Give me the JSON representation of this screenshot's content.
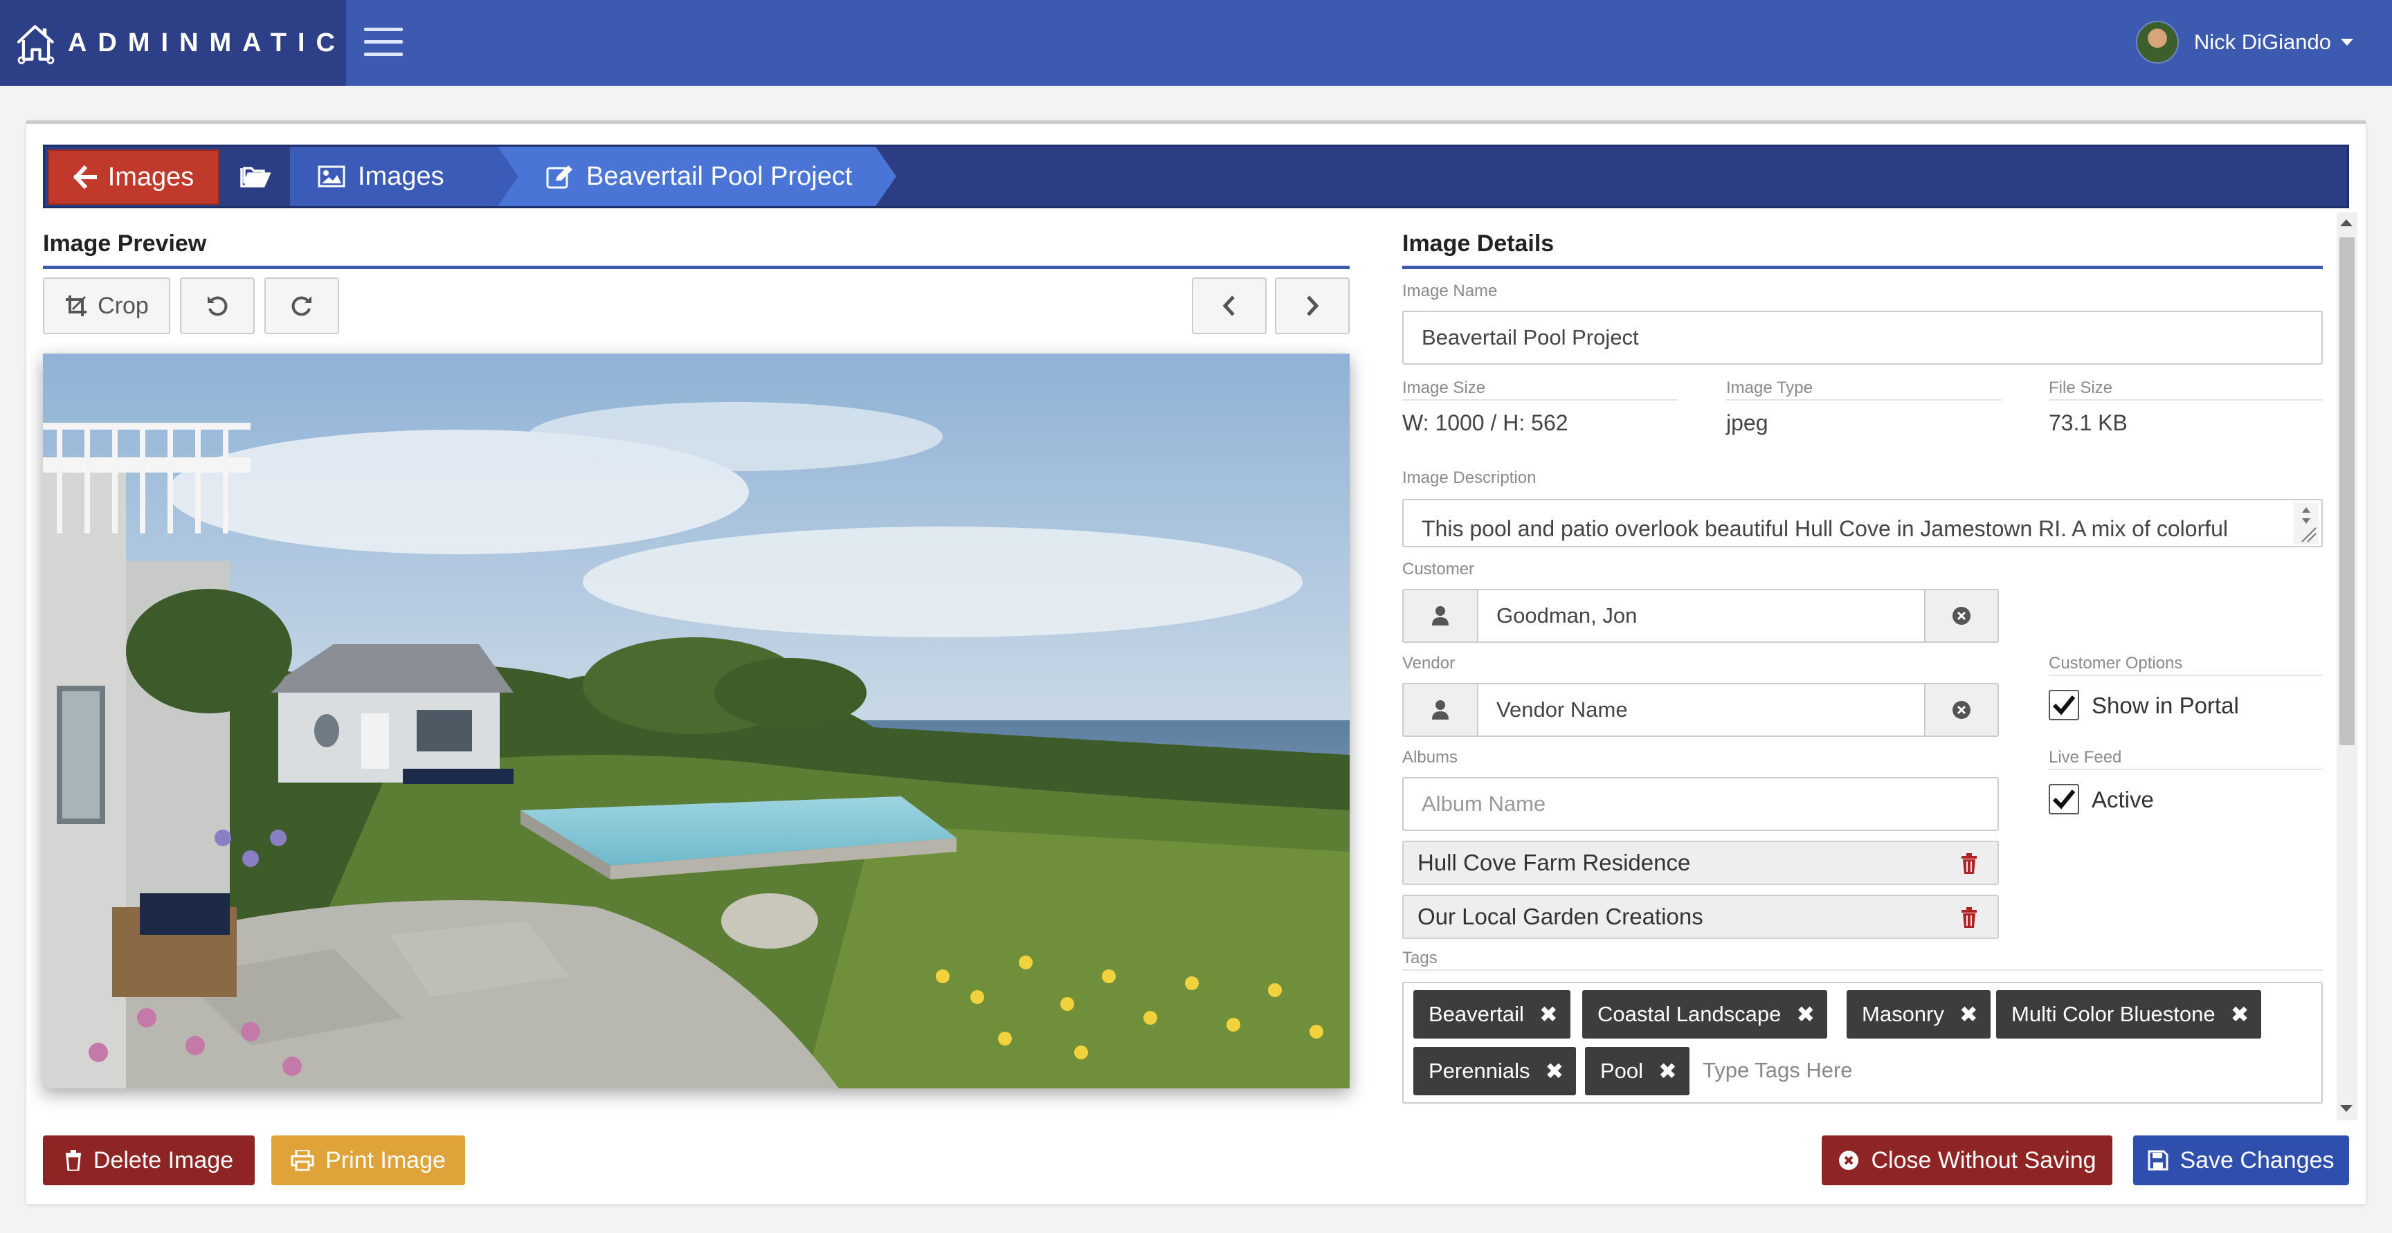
{
  "app": {
    "brand": "ADMINMATIC",
    "user_name": "Nick DiGiando"
  },
  "breadcrumb": {
    "back_label": "Images",
    "images_label": "Images",
    "current_label": "Beavertail Pool Project"
  },
  "preview": {
    "title": "Image Preview",
    "crop_label": "Crop"
  },
  "details": {
    "title": "Image Details",
    "name_label": "Image Name",
    "name_value": "Beavertail Pool Project",
    "size_label": "Image Size",
    "size_value": "W: 1000 / H: 562",
    "type_label": "Image Type",
    "type_value": "jpeg",
    "file_size_label": "File Size",
    "file_size_value": "73.1 KB",
    "description_label": "Image Description",
    "description_value": "This pool and patio overlook beautiful Hull Cove in Jamestown RI.  A mix of colorful",
    "customer_label": "Customer",
    "customer_value": "Goodman, Jon",
    "vendor_label": "Vendor",
    "vendor_placeholder": "Vendor Name",
    "albums_label": "Albums",
    "album_placeholder": "Album Name",
    "albums": [
      "Hull Cove Farm Residence",
      "Our Local Garden Creations"
    ],
    "customer_options_label": "Customer Options",
    "show_in_portal_label": "Show in Portal",
    "show_in_portal_checked": true,
    "live_feed_label": "Live Feed",
    "active_label": "Active",
    "active_checked": true,
    "tags_label": "Tags",
    "tags": [
      "Beavertail",
      "Coastal Landscape",
      "Masonry",
      "Multi Color Bluestone",
      "Perennials",
      "Pool"
    ],
    "tags_placeholder": "Type Tags Here"
  },
  "footer": {
    "delete_label": "Delete Image",
    "print_label": "Print Image",
    "close_label": "Close Without Saving",
    "save_label": "Save Changes"
  },
  "colors": {
    "topbar": "#3c5ab0",
    "brand_bg": "#2d3f86",
    "danger": "#8e2424",
    "warning": "#e0a33a",
    "save": "#2f4fae"
  },
  "icons": {
    "brand": "house-logo-icon",
    "menu": "hamburger-icon",
    "back": "arrow-left-icon",
    "folder": "folder-open-icon",
    "image": "image-icon",
    "edit": "edit-icon",
    "crop": "crop-icon",
    "rotate_left": "rotate-left-icon",
    "rotate_right": "rotate-right-icon",
    "prev": "chevron-left-icon",
    "next": "chevron-right-icon",
    "user": "user-icon",
    "clear": "times-circle-icon",
    "trash": "trash-icon",
    "print": "print-icon",
    "save": "floppy-disk-icon"
  }
}
